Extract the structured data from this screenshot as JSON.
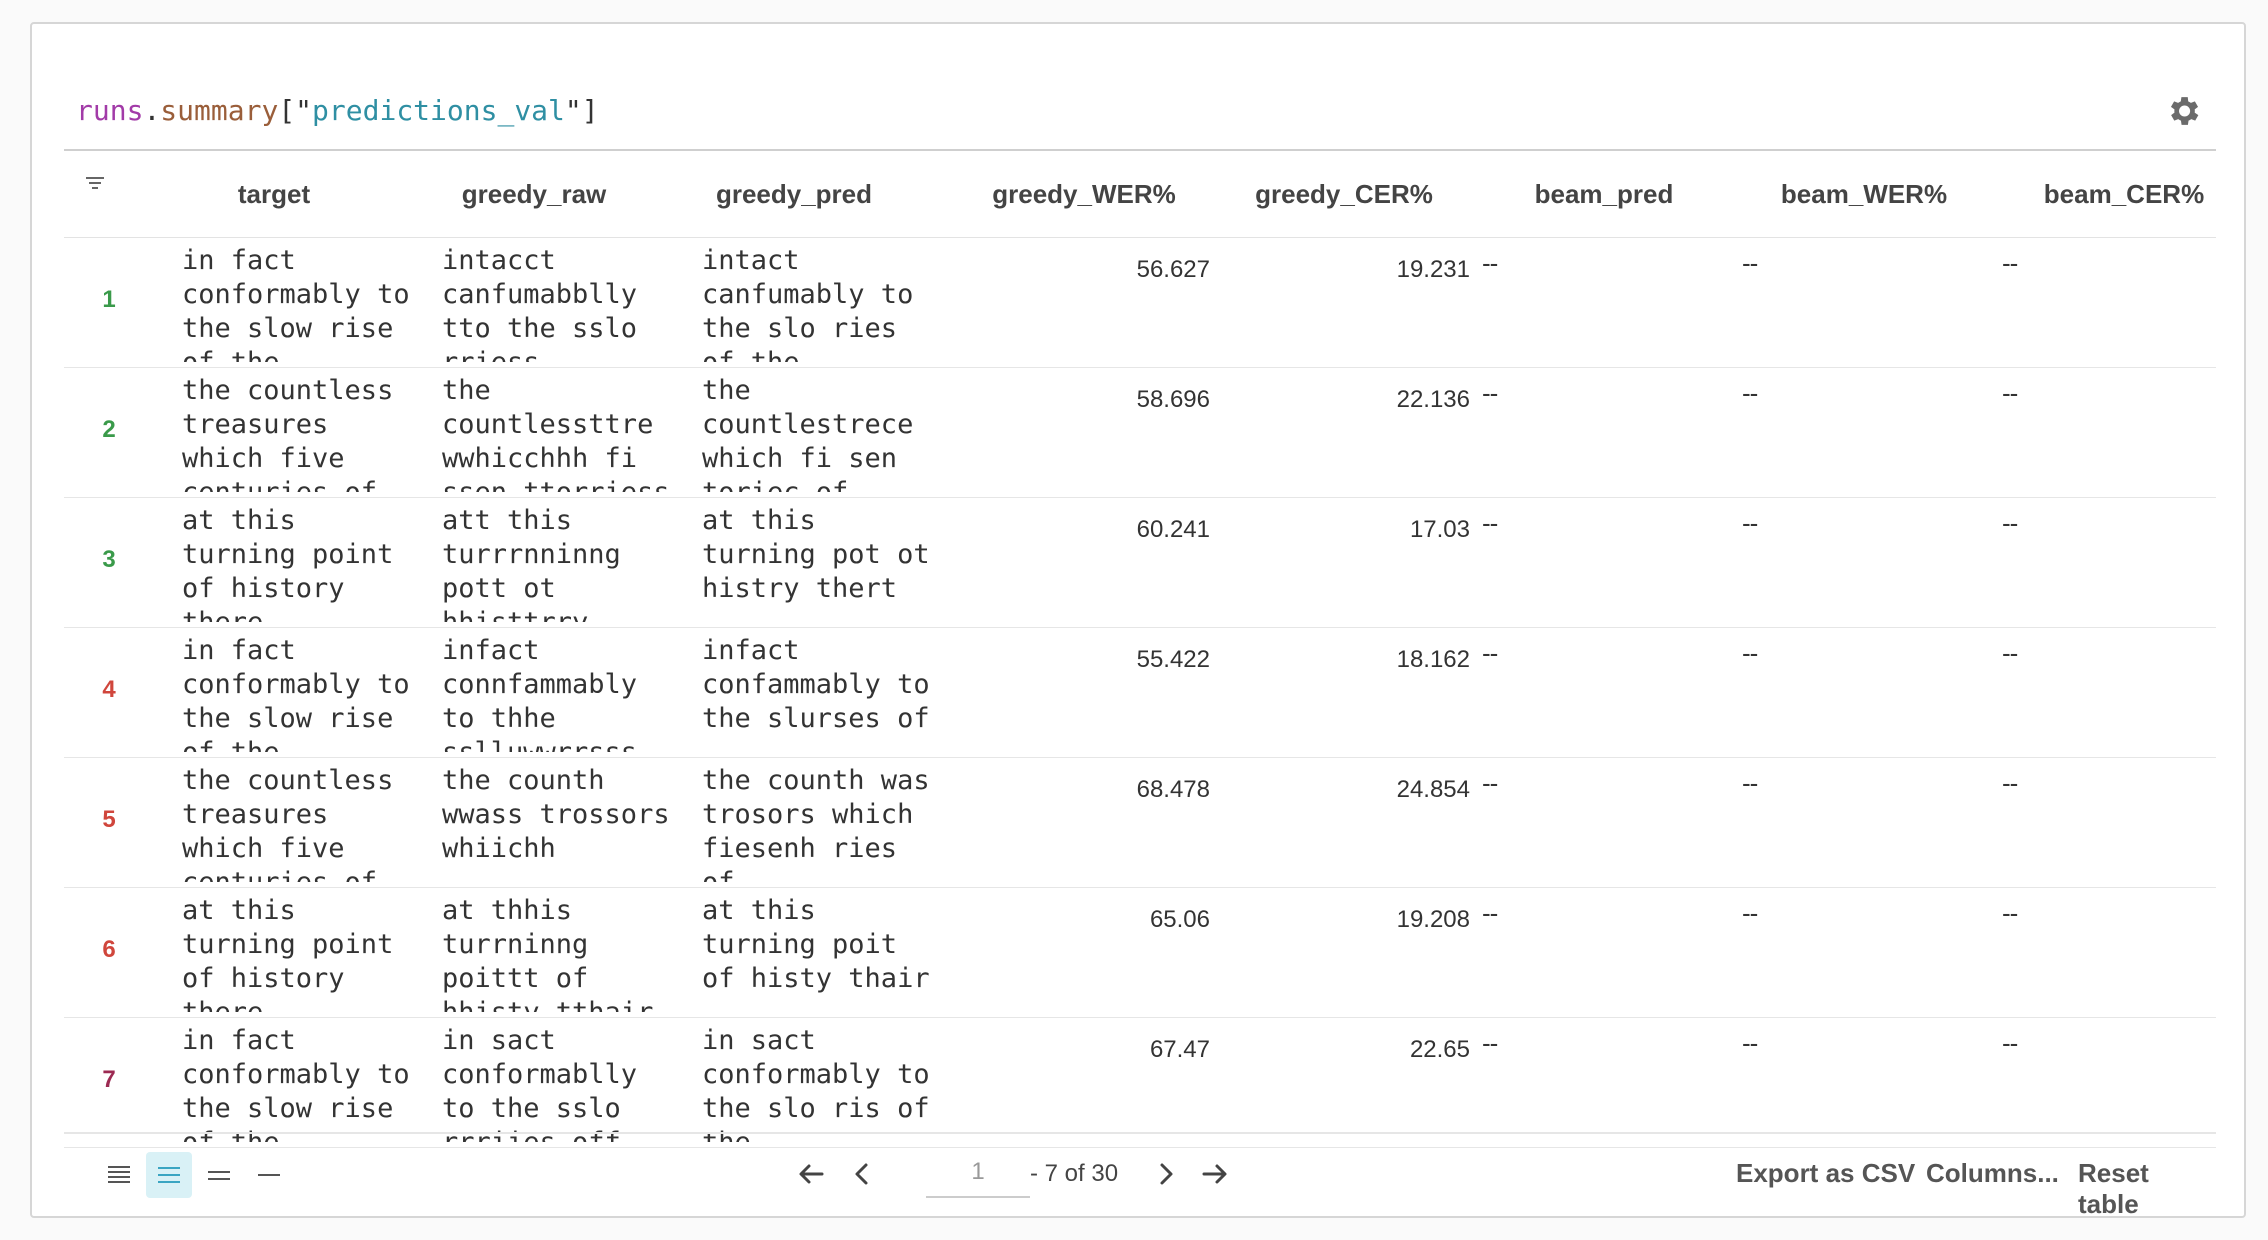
{
  "query": {
    "object": "runs",
    "dot": ".",
    "property": "summary",
    "open": "[\"",
    "key": "predictions_val",
    "close": "\"]"
  },
  "columns": [
    "target",
    "greedy_raw",
    "greedy_pred",
    "greedy_WER%",
    "greedy_CER%",
    "beam_pred",
    "beam_WER%",
    "beam_CER%"
  ],
  "empty_value": "--",
  "rows": [
    {
      "index": "1",
      "index_color": "#3a9a4a",
      "target": "in fact conformably to the slow rise of the",
      "greedy_raw": "intacct canfumabblly tto  the sslo  rriess",
      "greedy_pred": "intact canfumably to the slo ries of the",
      "greedy_wer": "56.627",
      "greedy_cer": "19.231"
    },
    {
      "index": "2",
      "index_color": "#3a9a4a",
      "target": "the countless treasures which five centuries of",
      "greedy_raw": "the countlessttre wwhicchhh fi ssen ttorriess",
      "greedy_pred": "the countlestrece which fi sen toriec of",
      "greedy_wer": "58.696",
      "greedy_cer": "22.136"
    },
    {
      "index": "3",
      "index_color": "#3a9a4a",
      "target": "at this turning point of history there",
      "greedy_raw": "att this turrrnninng pott  ot hhisttrry",
      "greedy_pred": "at this turning pot ot histry thert",
      "greedy_wer": "60.241",
      "greedy_cer": "17.03"
    },
    {
      "index": "4",
      "index_color": "#d0463c",
      "target": "in fact conformably to the slow rise of the",
      "greedy_raw": "infact connfammably to  thhe sslluwwrrsss",
      "greedy_pred": "infact confammably to the slurses of",
      "greedy_wer": "55.422",
      "greedy_cer": "18.162"
    },
    {
      "index": "5",
      "index_color": "#d0463c",
      "target": "the countless treasures which five centuries of",
      "greedy_raw": "the  counth wwass trossors whiichh",
      "greedy_pred": "the counth was trosors which fiesenh ries of",
      "greedy_wer": "68.478",
      "greedy_cer": "24.854"
    },
    {
      "index": "6",
      "index_color": "#d0463c",
      "target": "at this turning point of history there",
      "greedy_raw": "at thhis turrninng poittt of hhisty tthair",
      "greedy_pred": "at this turning poit of histy thair",
      "greedy_wer": "65.06",
      "greedy_cer": "19.208"
    },
    {
      "index": "7",
      "index_color": "#9c2a52",
      "target": "in fact conformably to the slow rise of the",
      "greedy_raw": "in sact conformablly to  the  sslo rrriies off",
      "greedy_pred": "in sact conformably to the slo ris of the",
      "greedy_wer": "67.47",
      "greedy_cer": "22.65"
    }
  ],
  "pagination": {
    "page": "1",
    "of_text": "- 7 of 30"
  },
  "footer_buttons": {
    "export": "Export as CSV",
    "columns": "Columns...",
    "reset": "Reset table"
  },
  "icons": [
    "gear-icon",
    "filter-icon",
    "density-extra-compact-icon",
    "density-compact-icon",
    "density-normal-icon",
    "density-single-line-icon",
    "first-page-icon",
    "prev-page-icon",
    "next-page-icon",
    "last-page-icon"
  ],
  "colors": {
    "accent": "#d9f1f6",
    "query_object": "#a23ba8",
    "query_string": "#2f8fa3"
  }
}
